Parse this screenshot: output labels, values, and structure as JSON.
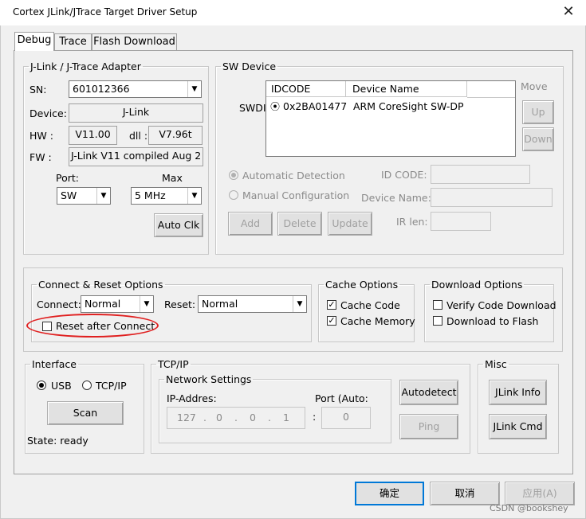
{
  "window": {
    "title": "Cortex JLink/JTrace Target Driver Setup",
    "close_glyph": "✕"
  },
  "tabs": [
    {
      "label": "Debug"
    },
    {
      "label": "Trace"
    },
    {
      "label": "Flash Download"
    }
  ],
  "adapter": {
    "legend": "J-Link / J-Trace Adapter",
    "sn_label": "SN:",
    "sn_value": "601012366",
    "device_label": "Device:",
    "device_value": "J-Link",
    "hw_label": "HW :",
    "hw_value": "V11.00",
    "dll_label": "dll :",
    "dll_value": "V7.96t",
    "fw_label": "FW :",
    "fw_value": "J-Link  V11 compiled Aug 2",
    "port_label": "Port:",
    "port_value": "SW",
    "max_label": "Max",
    "max_value": "5 MHz",
    "auto_clk_label": "Auto Clk"
  },
  "sw_device": {
    "legend": "SW Device",
    "move_label": "Move",
    "up_label": "Up",
    "down_label": "Down",
    "swdi_label": "SWDI",
    "columns": [
      "IDCODE",
      "Device Name"
    ],
    "rows": [
      {
        "idcode": "0x2BA01477",
        "device_name": "ARM CoreSight SW-DP"
      }
    ],
    "auto_detection_label": "Automatic Detection",
    "manual_config_label": "Manual Configuration",
    "id_code_label": "ID CODE:",
    "device_name_label": "Device Name:",
    "ir_len_label": "IR len:",
    "add_label": "Add",
    "delete_label": "Delete",
    "update_label": "Update"
  },
  "connect_reset": {
    "legend": "Connect & Reset Options",
    "connect_label": "Connect:",
    "connect_value": "Normal",
    "reset_label": "Reset:",
    "reset_value": "Normal",
    "reset_after_connect_label": "Reset after Connect",
    "reset_after_connect_checked": false
  },
  "cache_options": {
    "legend": "Cache Options",
    "cache_code_label": "Cache Code",
    "cache_code_checked": true,
    "cache_memory_label": "Cache Memory",
    "cache_memory_checked": true
  },
  "download_options": {
    "legend": "Download Options",
    "verify_label": "Verify Code Download",
    "verify_checked": false,
    "download_flash_label": "Download to Flash",
    "download_flash_checked": false
  },
  "interface": {
    "legend": "Interface",
    "usb_label": "USB",
    "tcpip_label": "TCP/IP",
    "selected": "USB",
    "scan_label": "Scan",
    "state_text": "State: ready"
  },
  "tcpip": {
    "legend": "TCP/IP",
    "network_legend": "Network Settings",
    "ip_label": "IP-Addres:",
    "port_label": "Port (Auto:",
    "ip_octets": [
      "127",
      "0",
      "0",
      "1"
    ],
    "dot": ".",
    "colon": ":",
    "port_value": "0",
    "autodetect_label": "Autodetect",
    "ping_label": "Ping"
  },
  "misc": {
    "legend": "Misc",
    "jlink_info_label": "JLink Info",
    "jlink_cmd_label": "JLink Cmd"
  },
  "footer": {
    "ok_label": "确定",
    "cancel_label": "取消",
    "apply_label": "应用(A)"
  },
  "watermark": "CSDN @bookshey",
  "colors": {
    "annotation": "#e02020",
    "dialog_bg": "#f0f0f0"
  }
}
